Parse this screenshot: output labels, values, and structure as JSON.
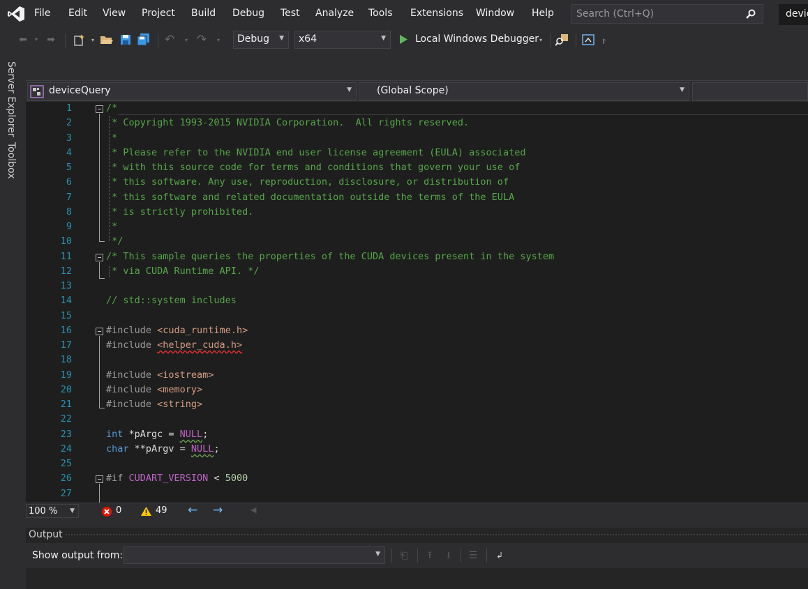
{
  "menu": {
    "items": [
      "File",
      "Edit",
      "View",
      "Project",
      "Build",
      "Debug",
      "Test",
      "Analyze",
      "Tools",
      "Extensions",
      "Window",
      "Help"
    ],
    "search_placeholder": "Search (Ctrl+Q)",
    "title_tab": "devic"
  },
  "toolbar": {
    "config": "Debug",
    "platform": "x64",
    "debugger": "Local Windows Debugger"
  },
  "side_tabs": [
    "Server Explorer",
    "Toolbox"
  ],
  "navbar": {
    "project": "deviceQuery",
    "scope": "(Global Scope)"
  },
  "code": {
    "lines": [
      "/*",
      " * Copyright 1993-2015 NVIDIA Corporation.  All rights reserved.",
      " *",
      " * Please refer to the NVIDIA end user license agreement (EULA) associated",
      " * with this source code for terms and conditions that govern your use of",
      " * this software. Any use, reproduction, disclosure, or distribution of",
      " * this software and related documentation outside the terms of the EULA",
      " * is strictly prohibited.",
      " *",
      " */",
      "/* This sample queries the properties of the CUDA devices present in the system",
      " * via CUDA Runtime API. */",
      "",
      "// std::system includes",
      "",
      "#include <cuda_runtime.h>",
      "#include <helper_cuda.h>",
      "",
      "#include <iostream>",
      "#include <memory>",
      "#include <string>",
      "",
      "int *pArgc = NULL;",
      "char **pArgv = NULL;",
      "",
      "#if CUDART_VERSION < 5000",
      ""
    ]
  },
  "status": {
    "zoom": "100 %",
    "errors": "0",
    "warnings": "49"
  },
  "output": {
    "title": "Output",
    "show_from_label": "Show output from:",
    "source": ""
  }
}
